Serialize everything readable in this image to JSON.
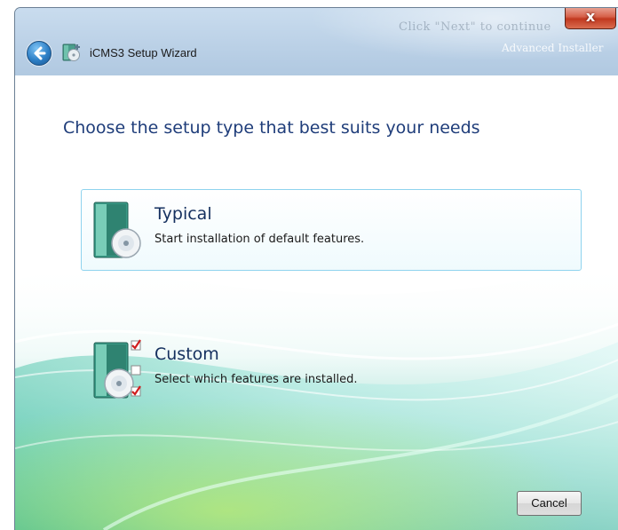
{
  "window": {
    "title": "iCMS3 Setup Wizard",
    "close_label": "x",
    "brand_text": "Advanced Installer",
    "blurred_text": "Click \"Next\" to continue"
  },
  "page": {
    "heading": "Choose the setup type that best suits your needs"
  },
  "options": [
    {
      "title": "Typical",
      "description": "Start installation of default features.",
      "icon": "cd-box-icon",
      "selected": true
    },
    {
      "title": "Custom",
      "description": "Select which features are installed.",
      "icon": "cd-box-checklist-icon",
      "selected": false
    }
  ],
  "buttons": {
    "cancel": "Cancel"
  },
  "colors": {
    "heading": "#1f3d7a",
    "accent_border": "#8fd3ee",
    "close_red": "#c1381f",
    "teal": "#3fbfa6"
  }
}
